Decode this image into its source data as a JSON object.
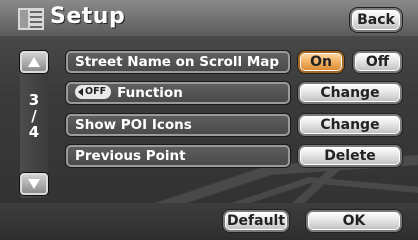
{
  "header": {
    "title": "Setup",
    "back_label": "Back",
    "icon": "list-icon"
  },
  "pager": {
    "current": "3",
    "separator": "/",
    "total": "4",
    "up_icon": "chevron-up-icon",
    "down_icon": "chevron-down-icon"
  },
  "rows": [
    {
      "label": "Street Name on Scroll Map",
      "options": [
        "On",
        "Off"
      ],
      "selected": "On"
    },
    {
      "label": "Function",
      "badge": "OFF",
      "action": "Change"
    },
    {
      "label": "Show POI Icons",
      "action": "Change"
    },
    {
      "label": "Previous Point",
      "action": "Delete"
    }
  ],
  "footer": {
    "default_label": "Default",
    "ok_label": "OK"
  },
  "colors": {
    "selected_button": "#f4b568",
    "row_background": "#555555",
    "header_background": "#6e6e6e"
  }
}
